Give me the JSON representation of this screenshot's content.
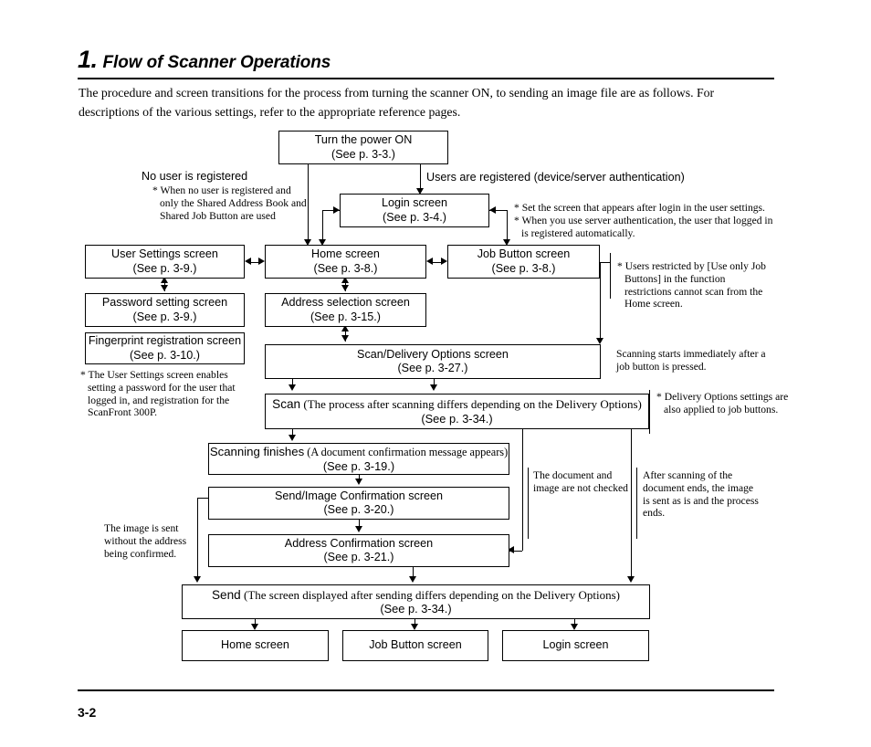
{
  "header": {
    "number": "1.",
    "title": "Flow of Scanner Operations"
  },
  "intro": "The procedure and screen transitions for the process from turning the scanner ON, to sending an image file are as follows. For descriptions of the various settings, refer to the appropriate reference pages.",
  "footer": {
    "page_number": "3-2"
  },
  "flowchart": {
    "boxes": {
      "power_on": {
        "line1": "Turn the power ON",
        "line2": "(See p. 3-3.)"
      },
      "login": {
        "line1": "Login screen",
        "line2": "(See p. 3-4.)"
      },
      "user_settings": {
        "line1": "User Settings screen",
        "line2": "(See p. 3-9.)"
      },
      "home": {
        "line1": "Home screen",
        "line2": "(See p. 3-8.)"
      },
      "job_button": {
        "line1": "Job Button screen",
        "line2": "(See p. 3-8.)"
      },
      "password": {
        "line1": "Password setting screen",
        "line2": "(See p. 3-9.)"
      },
      "address_sel": {
        "line1": "Address selection screen",
        "line2": "(See p. 3-15.)"
      },
      "fingerprint": {
        "line1": "Fingerprint registration screen",
        "line2": "(See p. 3-10.)"
      },
      "scan_delivery": {
        "line1": "Scan/Delivery Options screen",
        "line2": "(See p. 3-27.)"
      },
      "scan": {
        "bold": "Scan",
        "rest": " (The process after scanning differs depending on the Delivery Options)",
        "line2": "(See p. 3-34.)"
      },
      "scanning_fin": {
        "bold": "Scanning finishes",
        "rest": " (A document confirmation message appears)",
        "line2": "(See p. 3-19.)"
      },
      "send_image": {
        "line1": "Send/Image Confirmation screen",
        "line2": "(See p. 3-20.)"
      },
      "address_conf": {
        "line1": "Address Confirmation screen",
        "line2": "(See p. 3-21.)"
      },
      "send": {
        "bold": "Send",
        "rest": " (The screen displayed after sending differs depending on the Delivery Options)",
        "line2": "(See p. 3-34.)"
      },
      "end_home": {
        "line1": "Home screen"
      },
      "end_job_button": {
        "line1": "Job Button screen"
      },
      "end_login": {
        "line1": "Login screen"
      }
    },
    "labels": {
      "no_user": "No user is registered",
      "users_registered": "Users are registered (device/server authentication)"
    },
    "notes": {
      "no_user_note": "* When no user is registered and only the Shared Address Book and Shared Job Button are used",
      "login_note_1": "* Set the screen that appears after login in the user settings.",
      "login_note_2": "* When you use server authentication, the user that logged in is registered automatically.",
      "job_restrict": "* Users restricted by [Use only Job Buttons] in the function restrictions cannot scan from the Home screen.",
      "user_settings_note": "* The User Settings screen enables setting a password for the user that logged in, and registration for the ScanFront 300P.",
      "scanning_starts": "Scanning starts immediately after a job button is pressed.",
      "delivery_opts": "* Delivery Options settings are also applied to job buttons.",
      "not_checked": "The document and image are not checked",
      "after_scanning": "After scanning of the document ends, the image is sent as is and the process ends.",
      "image_sent": "The image is sent without the address being confirmed."
    }
  }
}
